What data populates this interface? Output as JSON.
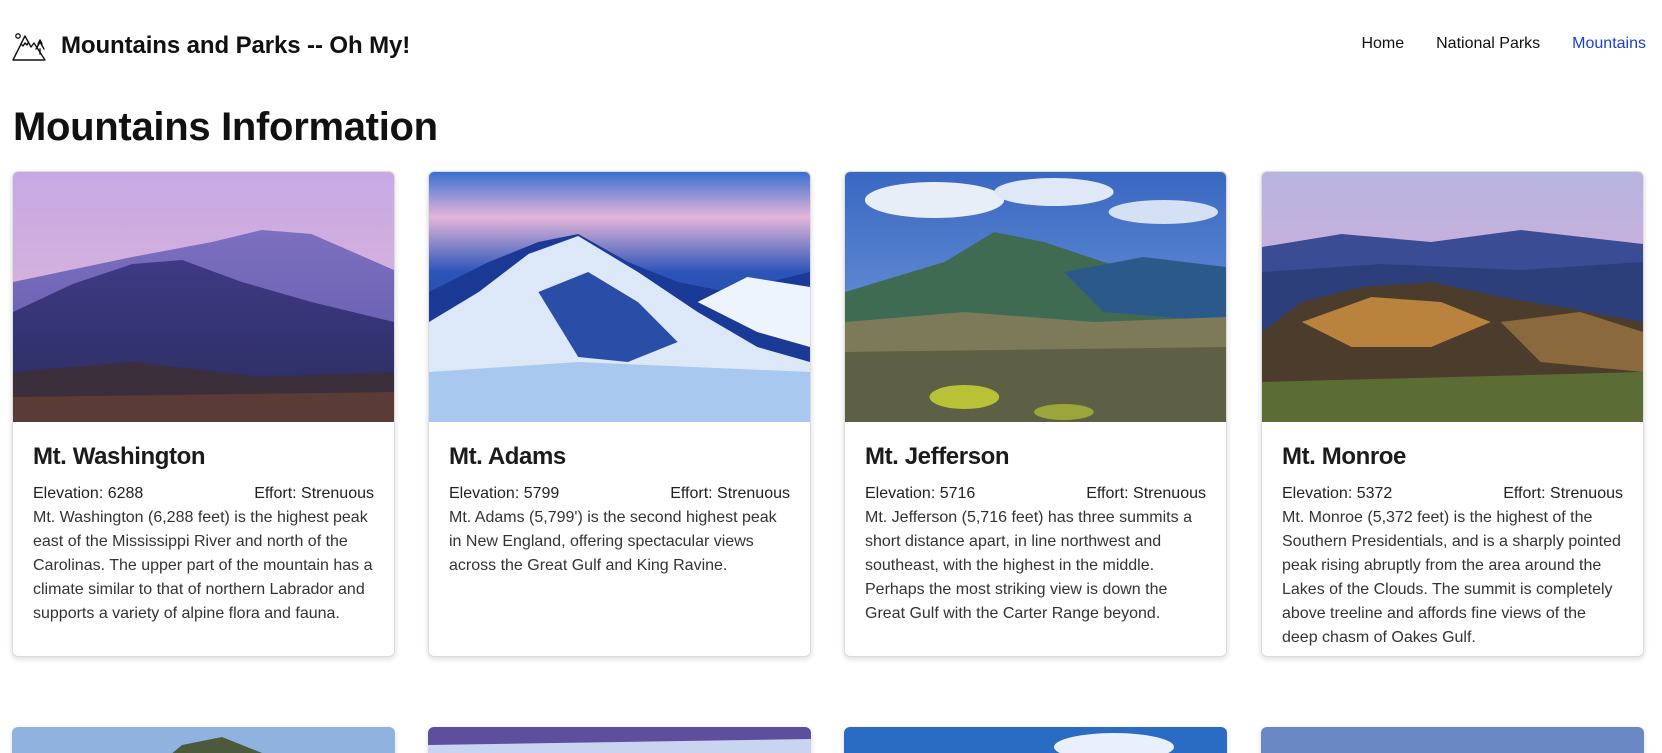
{
  "brand": {
    "title": "Mountains and Parks -- Oh My!",
    "icon": "mountain-logo-icon"
  },
  "nav": {
    "links": [
      {
        "label": "Home",
        "active": false
      },
      {
        "label": "National Parks",
        "active": false
      },
      {
        "label": "Mountains",
        "active": true
      }
    ],
    "active_color": "#1a3fd6"
  },
  "page": {
    "title": "Mountains Information"
  },
  "mountains": [
    {
      "name": "Mt. Washington",
      "elevation": "Elevation: 6288",
      "effort": "Effort: Strenuous",
      "description": "Mt. Washington (6,288 feet) is the highest peak east of the Mississippi River and north of the Carolinas. The upper part of the mountain has a climate similar to that of northern Labrador and supports a variety of alpine flora and fauna.",
      "image": "purple dusk mountain peak photo"
    },
    {
      "name": "Mt. Adams",
      "elevation": "Elevation: 5799",
      "effort": "Effort: Strenuous",
      "description": "Mt. Adams (5,799') is the second highest peak in New England, offering spectacular views across the Great Gulf and King Ravine.",
      "image": "snowy blue mountain photo"
    },
    {
      "name": "Mt. Jefferson",
      "elevation": "Elevation: 5716",
      "effort": "Effort: Strenuous",
      "description": "Mt. Jefferson (5,716 feet) has three summits a short distance apart, in line northwest and southeast, with the highest in the middle. Perhaps the most striking view is down the Great Gulf with the Carter Range beyond.",
      "image": "green summit with cloudy sky photo"
    },
    {
      "name": "Mt. Monroe",
      "elevation": "Elevation: 5372",
      "effort": "Effort: Strenuous",
      "description": "Mt. Monroe (5,372 feet) is the highest of the Southern Presidentials, and is a sharply pointed peak rising abruptly from the area around the Lakes of the Clouds. The summit is completely above treeline and affords fine views of the deep chasm of Oakes Gulf.",
      "image": "rocky golden summit photo"
    }
  ]
}
